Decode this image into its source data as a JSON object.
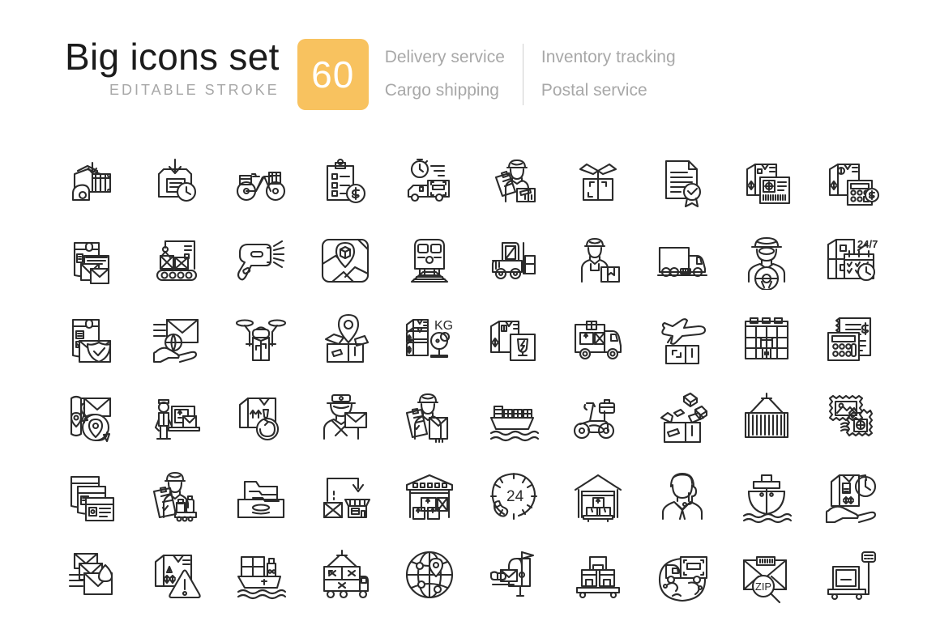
{
  "header": {
    "title": "Big icons set",
    "subtitle": "EDITABLE STROKE",
    "count": "60",
    "badge_color": "#f8c25f",
    "categories": [
      "Delivery service",
      "Cargo shipping",
      "Inventory tracking",
      "Postal service"
    ]
  },
  "grid": {
    "columns": 10,
    "rows": 6,
    "stroke_color": "#2b2b2b",
    "background": "#ffffff",
    "icons": [
      {
        "name": "parcel-loading-hook-icon",
        "label": "Parcel loading with hook"
      },
      {
        "name": "box-arrow-down-clock-icon",
        "label": "Package drop-off time"
      },
      {
        "name": "delivery-bicycle-icon",
        "label": "Delivery bicycle"
      },
      {
        "name": "clipboard-checklist-dollar-icon",
        "label": "Paid order checklist"
      },
      {
        "name": "express-truck-stopwatch-icon",
        "label": "Express truck delivery"
      },
      {
        "name": "courier-clipboard-parcel-icon",
        "label": "Courier with parcel"
      },
      {
        "name": "open-empty-box-icon",
        "label": "Opened box"
      },
      {
        "name": "certificate-document-icon",
        "label": "Certified document"
      },
      {
        "name": "parcel-label-barcode-icon",
        "label": "Parcel shipping label"
      },
      {
        "name": "parcel-calculator-cost-icon",
        "label": "Shipping cost calculator"
      },
      {
        "name": "mailbox-letters-icon",
        "label": "Mail letters sorting"
      },
      {
        "name": "conveyor-crane-parcel-icon",
        "label": "Conveyor parcel handling"
      },
      {
        "name": "barcode-scanner-icon",
        "label": "Barcode scanner"
      },
      {
        "name": "map-location-parcel-icon",
        "label": "Parcel location map"
      },
      {
        "name": "rail-freight-train-icon",
        "label": "Rail freight"
      },
      {
        "name": "forklift-icon",
        "label": "Forklift loader"
      },
      {
        "name": "warehouse-worker-icon",
        "label": "Warehouse worker"
      },
      {
        "name": "cargo-truck-icon",
        "label": "Cargo truck"
      },
      {
        "name": "truck-driver-icon",
        "label": "Truck driver"
      },
      {
        "name": "locker-schedule-24-7-icon",
        "label": "24/7 parcel locker",
        "text": "24/7"
      },
      {
        "name": "mail-shield-protection-icon",
        "label": "Mail protection"
      },
      {
        "name": "international-mail-hand-icon",
        "label": "International mail"
      },
      {
        "name": "delivery-drone-icon",
        "label": "Delivery drone"
      },
      {
        "name": "open-box-pin-icon",
        "label": "Package destination"
      },
      {
        "name": "weight-scale-parcels-icon",
        "label": "Parcel weight",
        "text": "KG"
      },
      {
        "name": "fragile-parcel-icon",
        "label": "Fragile goods"
      },
      {
        "name": "truck-loaded-parcels-icon",
        "label": "Loaded delivery truck"
      },
      {
        "name": "air-freight-plane-icon",
        "label": "Air freight"
      },
      {
        "name": "storage-shelves-icon",
        "label": "Storage shelving"
      },
      {
        "name": "invoice-calculator-icon",
        "label": "Invoice calculation"
      },
      {
        "name": "route-map-letter-icon",
        "label": "Mail route map"
      },
      {
        "name": "loader-worker-parcels-icon",
        "label": "Loader with parcels"
      },
      {
        "name": "box-return-arrow-icon",
        "label": "Package return"
      },
      {
        "name": "postman-letter-icon",
        "label": "Postman with letter"
      },
      {
        "name": "courier-clipboard-envelope-icon",
        "label": "Courier delivery receipt"
      },
      {
        "name": "container-cargo-ship-icon",
        "label": "Container cargo ship"
      },
      {
        "name": "delivery-scooter-icon",
        "label": "Delivery scooter"
      },
      {
        "name": "packing-box-items-icon",
        "label": "Packing goods"
      },
      {
        "name": "shipping-container-crane-icon",
        "label": "Shipping container lift"
      },
      {
        "name": "postage-stamps-icon",
        "label": "Postage stamps"
      },
      {
        "name": "mail-documents-stack-icon",
        "label": "Mail documents"
      },
      {
        "name": "courier-checklist-goods-icon",
        "label": "Goods checklist"
      },
      {
        "name": "file-drawer-archive-icon",
        "label": "Archive drawer"
      },
      {
        "name": "parcel-to-store-icon",
        "label": "Delivery to store"
      },
      {
        "name": "warehouse-boxes-icon",
        "label": "Warehouse storage"
      },
      {
        "name": "support-24-hours-icon",
        "label": "24 hour support",
        "text": "24"
      },
      {
        "name": "distribution-center-icon",
        "label": "Distribution center"
      },
      {
        "name": "support-operator-icon",
        "label": "Support operator"
      },
      {
        "name": "sea-freight-ship-icon",
        "label": "Sea freight ship"
      },
      {
        "name": "hand-parcel-timer-icon",
        "label": "Timely handover"
      },
      {
        "name": "urgent-mail-icon",
        "label": "Urgent mail"
      },
      {
        "name": "hazard-warning-parcel-icon",
        "label": "Hazardous parcel"
      },
      {
        "name": "container-vessel-icon",
        "label": "Container vessel"
      },
      {
        "name": "container-transport-truck-icon",
        "label": "Container transport"
      },
      {
        "name": "global-network-icon",
        "label": "Global shipping network"
      },
      {
        "name": "mailbox-hand-letter-icon",
        "label": "Letter to mailbox"
      },
      {
        "name": "pallet-boxes-icon",
        "label": "Palletized boxes"
      },
      {
        "name": "worldwide-truck-delivery-icon",
        "label": "Worldwide delivery"
      },
      {
        "name": "zip-code-search-icon",
        "label": "ZIP code lookup",
        "text": "ZIP"
      },
      {
        "name": "pallet-weighing-scale-icon",
        "label": "Pallet weighing scale"
      }
    ]
  }
}
